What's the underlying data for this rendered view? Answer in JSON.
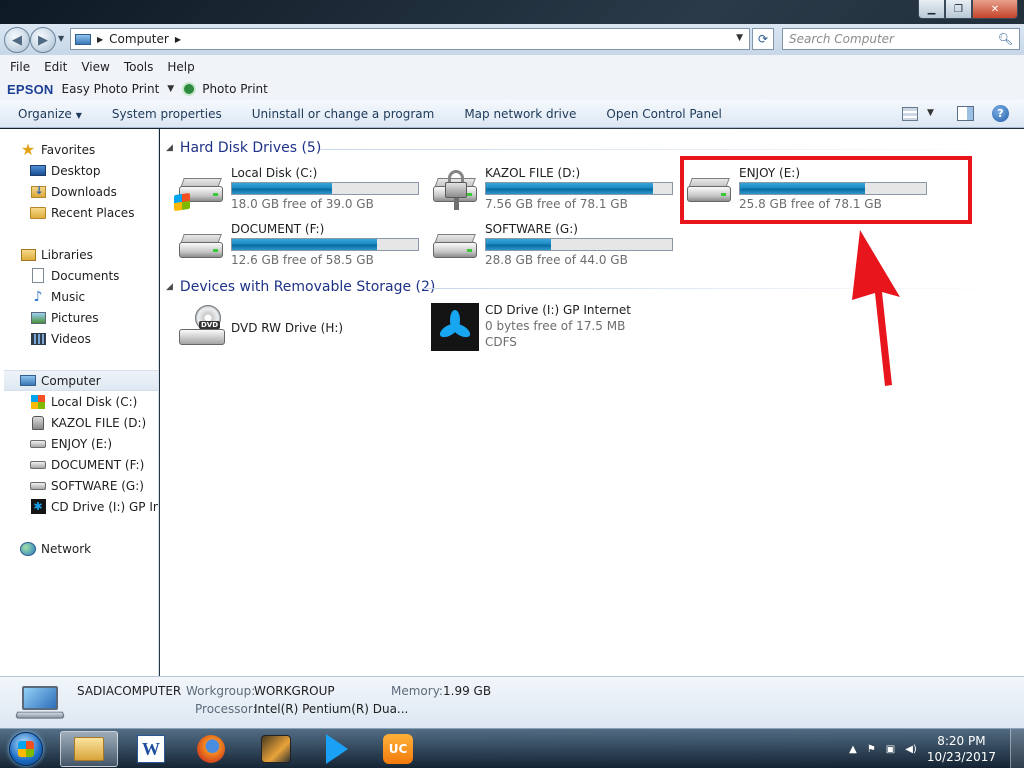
{
  "window": {
    "controls": {
      "minimize": "▁",
      "maximize": "❐",
      "close": "✕"
    }
  },
  "address": {
    "path": [
      "Computer"
    ],
    "search_placeholder": "Search Computer"
  },
  "menu": [
    "File",
    "Edit",
    "View",
    "Tools",
    "Help"
  ],
  "epson": {
    "logo": "EPSON",
    "easy_photo_print": "Easy Photo Print",
    "photo_print": "Photo Print"
  },
  "commands": {
    "organize": "Organize",
    "system_properties": "System properties",
    "uninstall": "Uninstall or change a program",
    "map_drive": "Map network drive",
    "control_panel": "Open Control Panel"
  },
  "nav": {
    "favorites": "Favorites",
    "desktop": "Desktop",
    "downloads": "Downloads",
    "recent": "Recent Places",
    "libraries": "Libraries",
    "documents": "Documents",
    "music": "Music",
    "pictures": "Pictures",
    "videos": "Videos",
    "computer": "Computer",
    "drive_c": "Local Disk (C:)",
    "drive_d": "KAZOL FILE (D:)",
    "drive_e": "ENJOY (E:)",
    "drive_f": "DOCUMENT (F:)",
    "drive_g": "SOFTWARE (G:)",
    "drive_i": "CD Drive (I:) GP Internet",
    "network": "Network"
  },
  "groups": {
    "hard_disks": "Hard Disk Drives (5)",
    "removable": "Devices with Removable Storage (2)"
  },
  "drives": [
    {
      "name": "Local Disk (C:)",
      "free": "18.0 GB free of 39.0 GB",
      "used_fraction": 0.54
    },
    {
      "name": "KAZOL FILE (D:)",
      "free": "7.56 GB free of 78.1 GB",
      "used_fraction": 0.9
    },
    {
      "name": "ENJOY (E:)",
      "free": "25.8 GB free of 78.1 GB",
      "used_fraction": 0.67
    },
    {
      "name": "DOCUMENT (F:)",
      "free": "12.6 GB free of 58.5 GB",
      "used_fraction": 0.78
    },
    {
      "name": "SOFTWARE (G:)",
      "free": "28.8 GB free of 44.0 GB",
      "used_fraction": 0.35
    }
  ],
  "removable": {
    "dvd": {
      "name": "DVD RW Drive (H:)",
      "badge": "DVD"
    },
    "cd": {
      "name": "CD Drive (I:) GP Internet",
      "free": "0 bytes free of 17.5 MB",
      "fs": "CDFS"
    }
  },
  "details": {
    "computer_name": "SADIACOMPUTER",
    "workgroup_label": "Workgroup:",
    "workgroup": "WORKGROUP",
    "memory_label": "Memory:",
    "memory": "1.99 GB",
    "processor_label": "Processor:",
    "processor": "Intel(R) Pentium(R) Dua..."
  },
  "taskbar": {
    "uc_label": "UC",
    "word_label": "W",
    "tray_arrow": "▲",
    "time": "8:20 PM",
    "date": "10/23/2017"
  },
  "colors": {
    "highlight": "#e8161c",
    "progress": "#1a8bc6",
    "group_header": "#1e3287"
  }
}
